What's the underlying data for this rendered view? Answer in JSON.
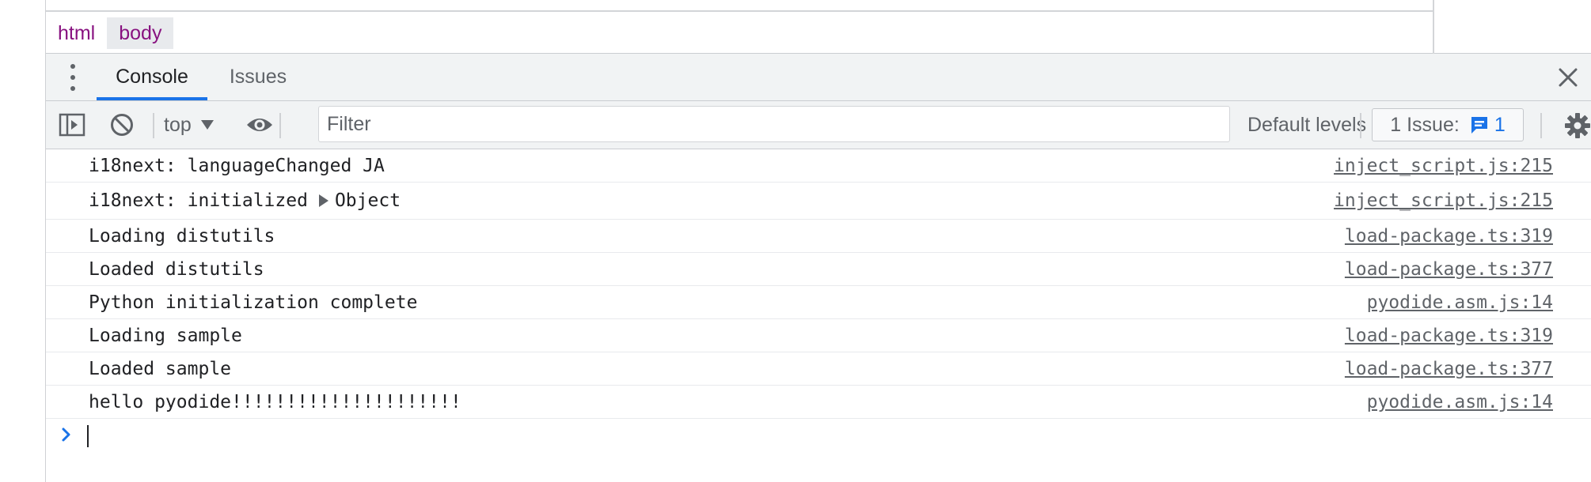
{
  "breadcrumb": {
    "items": [
      {
        "label": "html",
        "selected": false
      },
      {
        "label": "body",
        "selected": true
      }
    ]
  },
  "drawer": {
    "tabs": [
      {
        "label": "Console",
        "active": true
      },
      {
        "label": "Issues",
        "active": false
      }
    ]
  },
  "toolbar": {
    "context": "top",
    "filter_placeholder": "Filter",
    "filter_value": "",
    "levels_label": "Default levels",
    "issues_label": "1 Issue:",
    "issues_count": "1"
  },
  "console": {
    "messages": [
      {
        "text": "i18next: languageChanged JA",
        "source": "inject_script.js:215"
      },
      {
        "text": "i18next: initialized",
        "object_label": "Object",
        "source": "inject_script.js:215"
      },
      {
        "text": "Loading distutils",
        "source": "load-package.ts:319"
      },
      {
        "text": "Loaded distutils",
        "source": "load-package.ts:377"
      },
      {
        "text": "Python initialization complete",
        "source": "pyodide.asm.js:14"
      },
      {
        "text": "Loading sample",
        "source": "load-package.ts:319"
      },
      {
        "text": "Loaded sample",
        "source": "load-package.ts:377"
      },
      {
        "text": "hello pyodide!!!!!!!!!!!!!!!!!!!!!",
        "source": "pyodide.asm.js:14"
      }
    ],
    "prompt_value": ""
  },
  "colors": {
    "accent": "#1a73e8",
    "dom_tag": "#881280",
    "toolbar_bg": "#f1f3f4",
    "text": "#202124",
    "muted": "#5f6368"
  }
}
